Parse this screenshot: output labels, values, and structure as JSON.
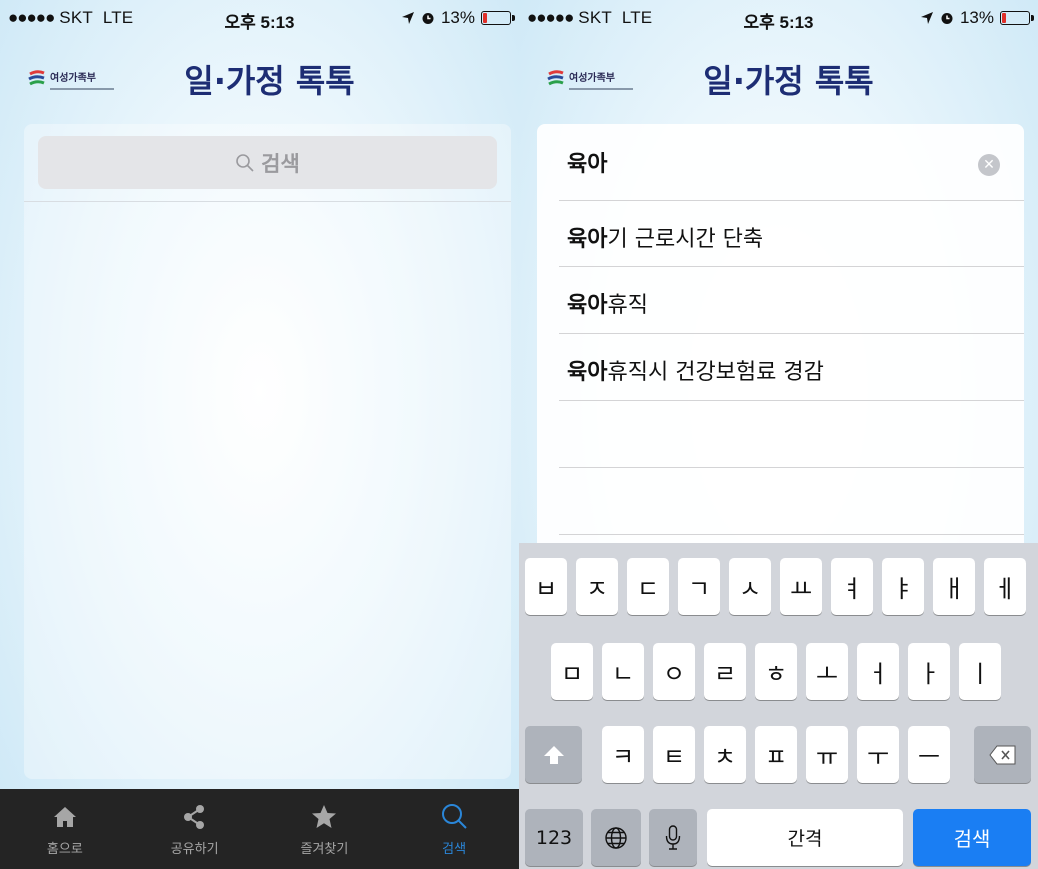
{
  "status": {
    "carrier_dots": "●●●●●",
    "carrier": "SKT",
    "network": "LTE",
    "time": "오후 5:13",
    "battery": "13%",
    "battery_level": 0.13
  },
  "nav": {
    "logo_text": "여성가족부",
    "title": "일·가정 톡톡"
  },
  "left": {
    "search_placeholder": "검색",
    "tabs": [
      {
        "label": "홈으로",
        "icon": "home-icon"
      },
      {
        "label": "공유하기",
        "icon": "share-icon"
      },
      {
        "label": "즐겨찾기",
        "icon": "star-icon"
      },
      {
        "label": "검색",
        "icon": "search-icon"
      }
    ]
  },
  "right": {
    "query": "육아",
    "suggestions": [
      {
        "bold": "육아",
        "rest": "기 근로시간 단축"
      },
      {
        "bold": "육아",
        "rest": "휴직"
      },
      {
        "bold": "육아",
        "rest": "휴직시 건강보험료 경감"
      }
    ]
  },
  "keyboard": {
    "row1": [
      "ㅂ",
      "ㅈ",
      "ㄷ",
      "ㄱ",
      "ㅅ",
      "ㅛ",
      "ㅕ",
      "ㅑ",
      "ㅐ",
      "ㅔ"
    ],
    "row2": [
      "ㅁ",
      "ㄴ",
      "ㅇ",
      "ㄹ",
      "ㅎ",
      "ㅗ",
      "ㅓ",
      "ㅏ",
      "ㅣ"
    ],
    "row3": [
      "ㅋ",
      "ㅌ",
      "ㅊ",
      "ㅍ",
      "ㅠ",
      "ㅜ",
      "ㅡ"
    ],
    "numbers": "123",
    "space": "간격",
    "search": "검색"
  },
  "colors": {
    "nav_title": "#1d2d74",
    "tab_active": "#2a86d8",
    "search_key": "#1a7ef3"
  }
}
